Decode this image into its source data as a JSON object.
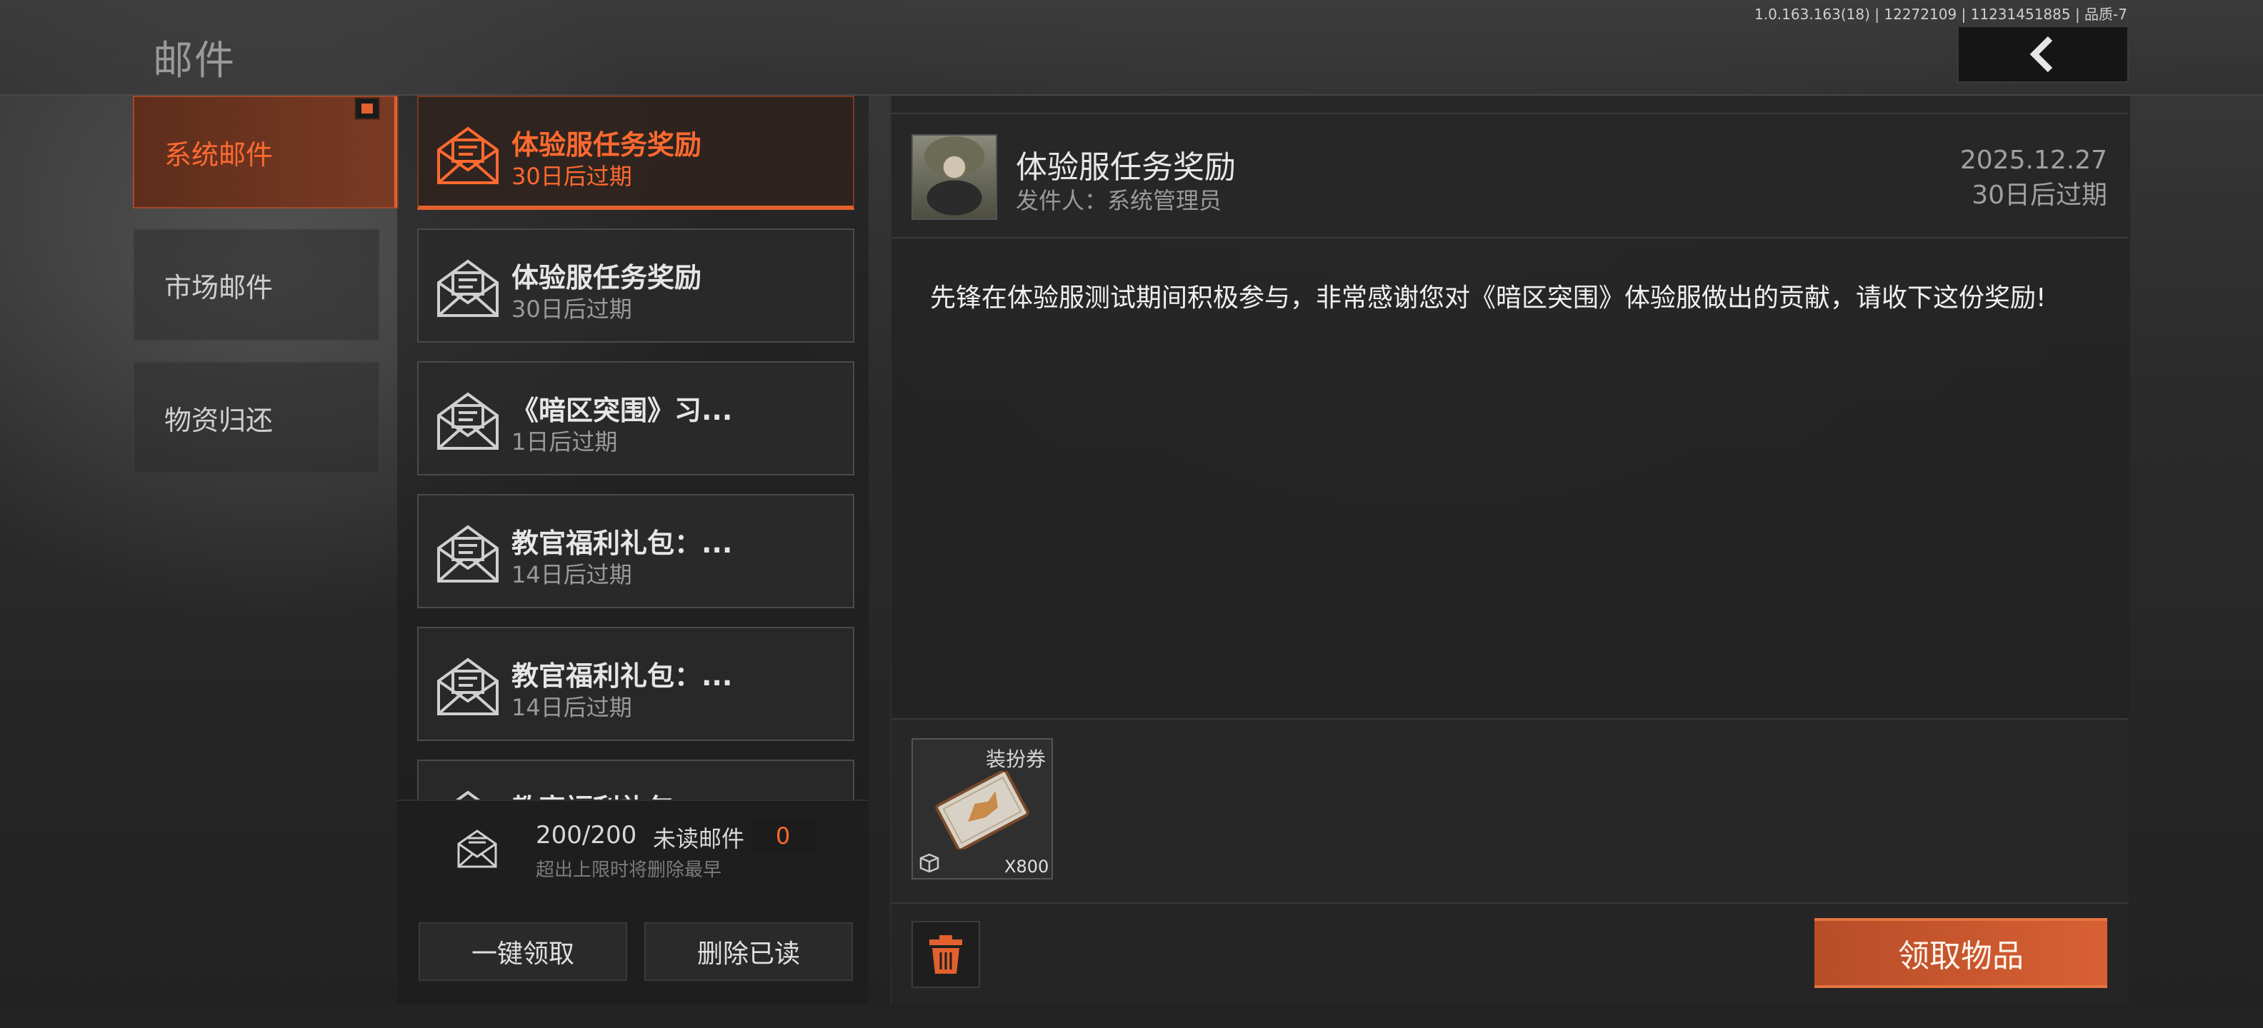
{
  "header": {
    "title": "邮件",
    "version": "1.0.163.163(18) | 12272109 | 11231451885 | 品质-7",
    "back_icon": "chevron-left-icon"
  },
  "categories": [
    {
      "label": "系统邮件",
      "active": true
    },
    {
      "label": "市场邮件",
      "active": false
    },
    {
      "label": "物资归还",
      "active": false
    }
  ],
  "mail_list": [
    {
      "title": "体验服任务奖励",
      "subtitle": "30日后过期",
      "active": true
    },
    {
      "title": "体验服任务奖励",
      "subtitle": "30日后过期",
      "active": false
    },
    {
      "title": "《暗区突围》习...",
      "subtitle": "1日后过期",
      "active": false
    },
    {
      "title": "教官福利礼包：...",
      "subtitle": "14日后过期",
      "active": false
    },
    {
      "title": "教官福利礼包：...",
      "subtitle": "14日后过期",
      "active": false
    },
    {
      "title": "教官福利礼包：",
      "subtitle": "",
      "active": false
    }
  ],
  "stats": {
    "count": "200/200",
    "unread_label": "未读邮件",
    "unread_count": "0",
    "note": "超出上限时将删除最早"
  },
  "list_buttons": {
    "claim_all": "一键领取",
    "delete_read": "删除已读"
  },
  "detail": {
    "title": "体验服任务奖励",
    "sender": "发件人：系统管理员",
    "date": "2025.12.27",
    "expire": "30日后过期",
    "body": "先锋在体验服测试期间积极参与，非常感谢您对《暗区突围》体验服做出的贡献，请收下这份奖励!",
    "attachment": {
      "label": "装扮券",
      "quantity": "X800",
      "icon": "costume-voucher-icon"
    },
    "claim_button": "领取物品",
    "delete_icon": "trash-icon"
  },
  "colors": {
    "accent": "#e2612e",
    "accent_text": "#ff6a30",
    "panel": "#2a2a2a"
  }
}
